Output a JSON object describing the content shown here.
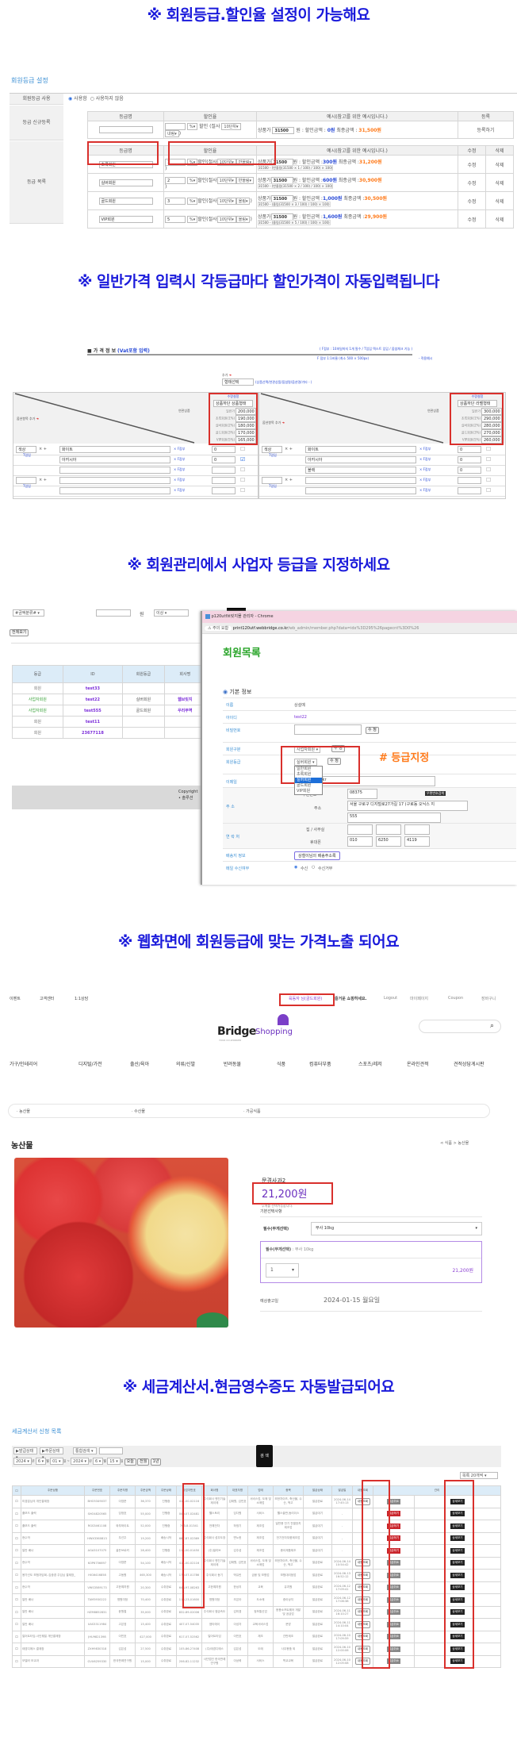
{
  "banners": {
    "b1": "※  회원등급.할인율 설정이 가능해요",
    "b2": "※ 일반가격 입력시 각등급마다 할인가격이 자동입력됩니다",
    "b3": "※  회원관리에서  사업자 등급을 지정하세요",
    "b4": "※  웹화면에  회원등급에 맞는 가격노출 되어요",
    "b5": "※ 세금계산서.현금영수증도 자동발급되어요"
  },
  "grade_settings": {
    "title": "회원등급 설정",
    "use_label": "회원등급 사용",
    "use_yes": "사용함",
    "use_no": "사용하지 않음",
    "new_label": "등급 신규등록",
    "list_label": "등급 목록",
    "col_name": "등급명",
    "col_rate": "할인율",
    "col_example": "예시(참고를 위한 예시입니다.)",
    "col_register": "등록",
    "col_edit": "수정",
    "col_delete": "삭제",
    "register_btn": "등록하기",
    "unit": "%",
    "discount": "할인",
    "cut_label": "(절사",
    "cut_unit": "10단위",
    "price_label": "상품가",
    "won_label": "원 : 할인금액 :",
    "final_label": "최종금액 :",
    "new_row": {
      "price": "31500",
      "discount": "0원",
      "final": "31,500원",
      "round": "내림"
    },
    "grades": [
      {
        "name": "초록회원",
        "rate": "1",
        "round": "반올림",
        "price": "31500",
        "discount": "300원",
        "final": "31,200원",
        "formula": "31500 - (반올림(31500 × 1 / 100) / 100) × 100)"
      },
      {
        "name": "실버회원",
        "rate": "2",
        "round": "반올림",
        "price": "31500",
        "discount": "600원",
        "final": "30,900원",
        "formula": "31500 - (반올림(31500 × 2 / 100) / 100) × 100)"
      },
      {
        "name": "골드회원",
        "rate": "3",
        "round": "올림",
        "price": "31500",
        "discount": "1,000원",
        "final": "30,500원",
        "formula": "31500 - (올림(31500 × 3 / 100) / 100) × 100)"
      },
      {
        "name": "VIP회원",
        "rate": "5",
        "round": "올림",
        "price": "31500",
        "discount": "1,600원",
        "final": "29,900원",
        "formula": "31500 - (올림(31500 × 5 / 100) / 100) × 100)"
      }
    ],
    "edit": "수정",
    "delete": "삭제"
  },
  "price_info": {
    "title": "■ 가 격 정 보",
    "title_sub": "(Vat포함 입력)",
    "note1": "( F접부 : 10파일까지 1개 필수 / T입입 텍스트 입입 /  옵셥체크 기능 )",
    "note2": "F 접부 1:1비율 (최소 500 × 500px)",
    "example_link": "- 적용예시",
    "add_label": "추가",
    "type_select": "형태선택",
    "type_hint": "(상품선택/연관상품/옵셥명/옵션명/기타 - )",
    "option_add": "옵션항목 추가",
    "related": "연관상품",
    "price_setting": "수량설정",
    "left_panel": {
      "mode": "상품하단 상품형태",
      "rows": [
        {
          "label": "일반가",
          "value": "200,000"
        },
        {
          "label": "초록회원(1%)",
          "value": "190,000"
        },
        {
          "label": "실버회원(2%)",
          "value": "180,000"
        },
        {
          "label": "골드회원(3%)",
          "value": "170,000"
        },
        {
          "label": "VIP회원(5%)",
          "value": "165,000"
        }
      ]
    },
    "right_panel": {
      "mode": "상품하단 라벨형태",
      "rows": [
        {
          "label": "일반가",
          "value": "300,000"
        },
        {
          "label": "초록회원(1%)",
          "value": "290,000"
        },
        {
          "label": "실버회원(2%)",
          "value": "280,000"
        },
        {
          "label": "골드회원(3%)",
          "value": "270,000"
        },
        {
          "label": "VIP회원(5%)",
          "value": "260,000"
        }
      ]
    },
    "option_name": "색상",
    "t_input": "T입입",
    "f_attach": "F접부",
    "left_options": [
      {
        "name": "화이트",
        "qty": "0",
        "checked": false
      },
      {
        "name": "아카시아",
        "qty": "0",
        "checked": true
      },
      {
        "name": "",
        "qty": "",
        "checked": false
      },
      {
        "name": "",
        "qty": "",
        "checked": false
      },
      {
        "name": "",
        "qty": "",
        "checked": false
      }
    ],
    "right_options": [
      {
        "name": "화이트",
        "qty": "0"
      },
      {
        "name": "아카시아",
        "qty": "0"
      },
      {
        "name": "블랙",
        "qty": "0"
      },
      {
        "name": "",
        "qty": ""
      },
      {
        "name": "",
        "qty": ""
      }
    ]
  },
  "member_mgmt": {
    "filter_select": "#금액분류#",
    "won": "원",
    "above": "이상",
    "view_all": "전체보기",
    "columns": [
      "등급",
      "ID",
      "회원등급",
      "회사명"
    ],
    "rows": [
      {
        "type": "회원",
        "id": "test33",
        "grade": "",
        "company": ""
      },
      {
        "type": "사업자회원",
        "id": "test22",
        "grade": "실버회원",
        "company": "웹브릿지"
      },
      {
        "type": "사업자회원",
        "id": "test555",
        "grade": "골드회원",
        "company": "우리무역"
      },
      {
        "type": "회원",
        "id": "test11",
        "grade": "",
        "company": ""
      },
      {
        "type": "회원",
        "id": "23677118",
        "grade": "",
        "company": ""
      }
    ],
    "footer": "Copyright",
    "footer2": "• 솔루션",
    "popup": {
      "window_title": "p120utf브릿지몰 관리자 - Chrome",
      "warning": "주의 요함",
      "url_host": "print120utf.webbridge.co.kr",
      "url_path": "/wb_admin/member.php?data=idx%3D295%26pagecnt%3D0%26",
      "page_title": "회원목록",
      "section": "기본 정보",
      "fields": {
        "name_label": "이름",
        "name_value": "상설예",
        "id_label": "아이디",
        "id_value": "test22",
        "pw_label": "비밀번호",
        "type_label": "회원구분",
        "type_value": "사업자회원",
        "grade_label": "회원등급",
        "grade_value": "실버회원",
        "email_label": "이메일",
        "email_value": "o.kr",
        "addr_label": "주 소",
        "zip_label": "우편번호",
        "zip_value": "08375",
        "zip_btn": "우편번호검색",
        "addr_sub": "주소",
        "addr1": "서울 구로구 디지털로27가길 17 (구로동 오닉스 지",
        "addr2": "555",
        "contact_label": "연 락 처",
        "office_label": "집 / 사무실",
        "mobile_label": "휴대폰",
        "mobile1": "010",
        "mobile2": "6250",
        "mobile3": "4119",
        "ship_label": "배송지 정보",
        "ship_btn": "상철이님의 배송주소록",
        "mail_label": "메일 수신여부",
        "mail_yes": "수신",
        "mail_no": "수신거부"
      },
      "edit_btn": "수 정",
      "grade_options": [
        "일반회원",
        "초록회원",
        "실버회원",
        "골드회원",
        "VIP회원"
      ],
      "grade_selected_index": 2,
      "annotation": "# 등급지정"
    }
  },
  "shop": {
    "top_links": [
      "이벤트",
      "고객센터",
      "1:1상담"
    ],
    "welcome_name": "육동자 님(골드회원)",
    "welcome_msg": "즐거운 쇼핑하세요.",
    "right_links": [
      "Logout",
      "마이페이지",
      "Coupon",
      "장바구니"
    ],
    "logo_main": "Bridge",
    "logo_sub": "Shopping",
    "logo_tag": "YOUR CO-WORKER",
    "nav": [
      "가구/인테리어",
      "디지털/가전",
      "출산/육아",
      "의류/신발",
      "반려동물",
      "식품",
      "컴퓨터부품",
      "스포츠/레저",
      "온라인견적",
      "견적상담게시판"
    ],
    "subcats": [
      "· 농산물",
      "· 수산물",
      "· 가공식품"
    ],
    "category_title": "농산물",
    "breadcrumb": "식품 > 농산물",
    "product_name": "문경사과2",
    "price": "21,200원",
    "weight_note": "무게를 선택가능합니다.",
    "options_title": "기본선택사항",
    "option_label": "필수(무게선택)",
    "option_value": "부사 10kg",
    "selected_label": "필수(무게선택)",
    "selected_value": ": 부사 10kg",
    "qty": "1",
    "line_price": "21,200원",
    "ship_date_label": "예상출고일",
    "ship_date": "2024-01-15 월요일"
  },
  "tax": {
    "title": "세금계산서 신청 목록",
    "filters": [
      "▶발급상태",
      "▶주문상태",
      "통합검색"
    ],
    "date_from": [
      "2024",
      "6",
      "01"
    ],
    "date_to": [
      "2024",
      "6",
      "15"
    ],
    "year_unit": "년",
    "month_unit": "월",
    "day_unit": "일",
    "quick": [
      "오늘",
      "전월",
      "1년"
    ],
    "search_btn": "검 색",
    "list_count": "목록 20개씩",
    "columns": [
      "주문상품",
      "주문번호",
      "주문자명",
      "주문금액",
      "주문상태",
      "사업자번호",
      "회사명",
      "대표자명",
      "업태",
      "종목",
      "발급상태",
      "발급일",
      "내용조회",
      "관리"
    ],
    "rows": [
      {
        "product": "미경분님의 개인결제창",
        "no": "BHO5349037",
        "buyer": "이영준",
        "amount": "36,370",
        "status": "진행중",
        "biz": "411-00-02116",
        "company": "주식회사 엔진기술 제이에",
        "ceo": "김태원, 김민호",
        "type": "서비스업, 도매 및 소매업",
        "item": "모한차이즈, 축산물, 수산, 떡고",
        "issue": "발급완료",
        "date": "2024-06-14 17:45:13",
        "view": true,
        "action": "발급취소"
      },
      {
        "product": "홀보드 출력",
        "no": "SHO4820565",
        "buyer": "임정호",
        "amount": "55,000",
        "status": "진행중",
        "biz": "000-07-02481",
        "company": "웰스토리",
        "ceo": "임다원",
        "type": "서비스",
        "item": "웰스출판,동리이스",
        "issue": "발급대기",
        "date": "-",
        "view": false,
        "action": "발급하기"
      },
      {
        "product": "홀보드 출력",
        "no": "RGS3461108",
        "buyer": "와부와이트",
        "amount": "52,000",
        "status": "진행중",
        "biz": "703-8-01341",
        "company": "전해전자",
        "ceo": "하정기",
        "type": "제조업",
        "item": "일반용 전기 전열장치 제조업",
        "issue": "발급대기",
        "date": "-",
        "view": false,
        "action": "발급하기"
      },
      {
        "product": "현수막",
        "no": "HWX3360813",
        "buyer": "우선주",
        "amount": "19,200",
        "status": "배송시작",
        "biz": "687-87-02369",
        "company": "주식회사 성우도장",
        "ceo": "변노헌",
        "type": "제조업",
        "item": "전기전자부품제조업",
        "issue": "발급대기",
        "date": "-",
        "view": false,
        "action": "발급하기"
      },
      {
        "product": "일반 배너",
        "no": "AGA3107075",
        "buyer": "골든브로커",
        "amount": "28,400",
        "status": "진행중",
        "biz": "114-00-01450",
        "company": "(주)빌리브",
        "ceo": "김주성",
        "type": "제조업",
        "item": "종이제품제조",
        "issue": "발급대기",
        "date": "-",
        "view": false,
        "action": "발급하기"
      },
      {
        "product": "현수막",
        "no": "KOP6756697",
        "buyer": "이영준",
        "amount": "54,100",
        "status": "배송시작",
        "biz": "411-00-02116",
        "company": "주식회사 엔진기술 제이에",
        "ceo": "김태원, 김민호",
        "type": "서비스업, 도매 및 소매업",
        "item": "모한차이즈, 축산물, 수산, 떡고",
        "issue": "발급완료",
        "date": "2024-06-14 10:54:42",
        "view": true,
        "action": "발급취소"
      },
      {
        "product": "용가선도 보험자담회..김중경 주임님 결제창_",
        "no": "HIG6416858",
        "buyer": "고동원",
        "amount": "465,300",
        "status": "배송시작",
        "biz": "170-07-01786",
        "company": "주식회사 동기",
        "ceo": "박유린",
        "type": "금융 및 보험업",
        "item": "보험대리점업",
        "issue": "발급완료",
        "date": "2024-06-13 16:52:12",
        "view": true,
        "action": "발급취소"
      },
      {
        "product": "현수막",
        "no": "VWS3589173",
        "buyer": "고한예치원",
        "amount": "20,300",
        "status": "수취완료",
        "biz": "648-97-08263",
        "company": "고한예치원",
        "ceo": "한상지",
        "type": "교육",
        "item": "유치원",
        "issue": "발급완료",
        "date": "2024-06-12 17:09:41",
        "view": true,
        "action": "발급취소"
      },
      {
        "product": "일반 배너",
        "no": "TAM3930222",
        "buyer": "명원미정",
        "amount": "70,400",
        "status": "수취완료",
        "biz": "116-23-01600",
        "company": "명원미정",
        "ceo": "조은아",
        "type": "도소매",
        "item": "중이상지",
        "issue": "발급완료",
        "date": "2024-06-12 17:08:38",
        "view": true,
        "action": "발급취소"
      },
      {
        "product": "일반 배너",
        "no": "HZM8852831",
        "buyer": "윤원철",
        "amount": "35,000",
        "status": "수취완료",
        "biz": "832-89-02006",
        "company": "주식회사 엠금속도",
        "ceo": "김미경",
        "type": "정보통신업",
        "item": "응용소프트웨어 개발 및 공급업",
        "issue": "발급완료",
        "date": "2024-06-11 16:10:27",
        "view": true,
        "action": "발급취소"
      },
      {
        "product": "일반 배너",
        "no": "UAS3311984",
        "buyer": "고은영",
        "amount": "15,400",
        "status": "수취완료",
        "biz": "407-07-54035",
        "company": "엠티에이",
        "ceo": "이성자",
        "type": "교육서비스업",
        "item": "문방",
        "issue": "발급완료",
        "date": "2024-06-11 14:10:04",
        "view": true,
        "action": "발급취소"
      },
      {
        "product": "일어트타임-사인웨일 개인결제창",
        "no": "JHU9821398",
        "buyer": "이민호",
        "amount": "427,000",
        "status": "수취완료",
        "biz": "617-07-52562",
        "company": "일어트타임",
        "ceo": "이민호",
        "type": "제조",
        "item": "간판제조",
        "issue": "발급완료",
        "date": "2024-06-10 17:09:59",
        "view": true,
        "action": "발급취소"
      },
      {
        "product": "태경디에스 결제창",
        "no": "ZXH9830318",
        "buyer": "김은성",
        "amount": "27,500",
        "status": "수취완료",
        "biz": "105-86-27408",
        "company": "(주)태경디에스",
        "ceo": "김은성",
        "type": "도매",
        "item": "사무용품 외",
        "issue": "발급완료",
        "date": "2024-06-10 12:00:06",
        "view": true,
        "action": "발급취소"
      },
      {
        "product": "모델러 모교과",
        "no": "GVU6259330",
        "buyer": "한국판례연구원",
        "amount": "15,000",
        "status": "수취완료",
        "biz": "206-82-11232",
        "company": "사단법인 한국판례연구원",
        "ceo": "이상혁",
        "type": "서비스",
        "item": "학교교육",
        "issue": "발급완료",
        "date": "2024-06-10 12:05:08",
        "view": true,
        "action": "발급취소"
      }
    ],
    "view_btn": "내용조회",
    "detail_btn": "상세보기"
  }
}
